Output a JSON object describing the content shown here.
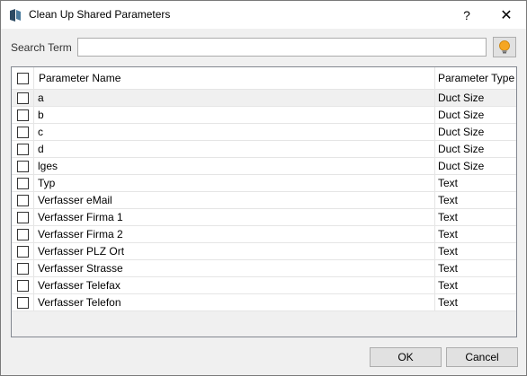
{
  "window": {
    "title": "Clean Up Shared Parameters",
    "help_label": "?",
    "close_label": "✕"
  },
  "search": {
    "label": "Search Term",
    "value": "",
    "placeholder": ""
  },
  "grid": {
    "columns": [
      "Parameter Name",
      "Parameter Type"
    ],
    "rows": [
      {
        "name": "a",
        "type": "Duct Size"
      },
      {
        "name": "b",
        "type": "Duct Size"
      },
      {
        "name": "c",
        "type": "Duct Size"
      },
      {
        "name": "d",
        "type": "Duct Size"
      },
      {
        "name": "lges",
        "type": "Duct Size"
      },
      {
        "name": "Typ",
        "type": "Text"
      },
      {
        "name": "Verfasser eMail",
        "type": "Text"
      },
      {
        "name": "Verfasser Firma 1",
        "type": "Text"
      },
      {
        "name": "Verfasser Firma 2",
        "type": "Text"
      },
      {
        "name": "Verfasser PLZ Ort",
        "type": "Text"
      },
      {
        "name": "Verfasser Strasse",
        "type": "Text"
      },
      {
        "name": "Verfasser Telefax",
        "type": "Text"
      },
      {
        "name": "Verfasser Telefon",
        "type": "Text"
      }
    ]
  },
  "footer": {
    "ok_label": "OK",
    "cancel_label": "Cancel"
  },
  "colors": {
    "accent": "#f5a623",
    "icon_blue": "#2c4a63"
  },
  "icons": {
    "app": "app-logo-icon",
    "bulb": "lightbulb-icon"
  }
}
